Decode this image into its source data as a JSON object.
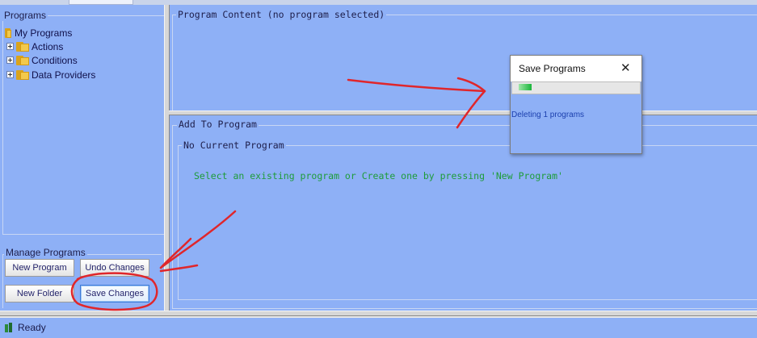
{
  "left_panel": {
    "tree_header": "Programs",
    "tree": {
      "root": "My Programs",
      "children": [
        "Actions",
        "Conditions",
        "Data Providers"
      ]
    },
    "manage_header": "Manage Programs",
    "buttons": {
      "new_program": "New Program",
      "undo_changes": "Undo Changes",
      "new_folder": "New Folder",
      "save_changes": "Save Changes"
    }
  },
  "program_content": {
    "header": "Program Content (no program selected)"
  },
  "add_to_program": {
    "header": "Add To Program",
    "sub_header": "No Current Program",
    "hint": "Select an existing program or Create one by pressing 'New Program'",
    "hint_color": "#1e9c3a"
  },
  "dialog": {
    "title": "Save Programs",
    "close_glyph": "✕",
    "message": "Deleting 1 programs",
    "progress_fraction": 0.1
  },
  "status": {
    "text": "Ready"
  },
  "colors": {
    "background": "#8eb0f6",
    "annotation": "#e0262b"
  }
}
